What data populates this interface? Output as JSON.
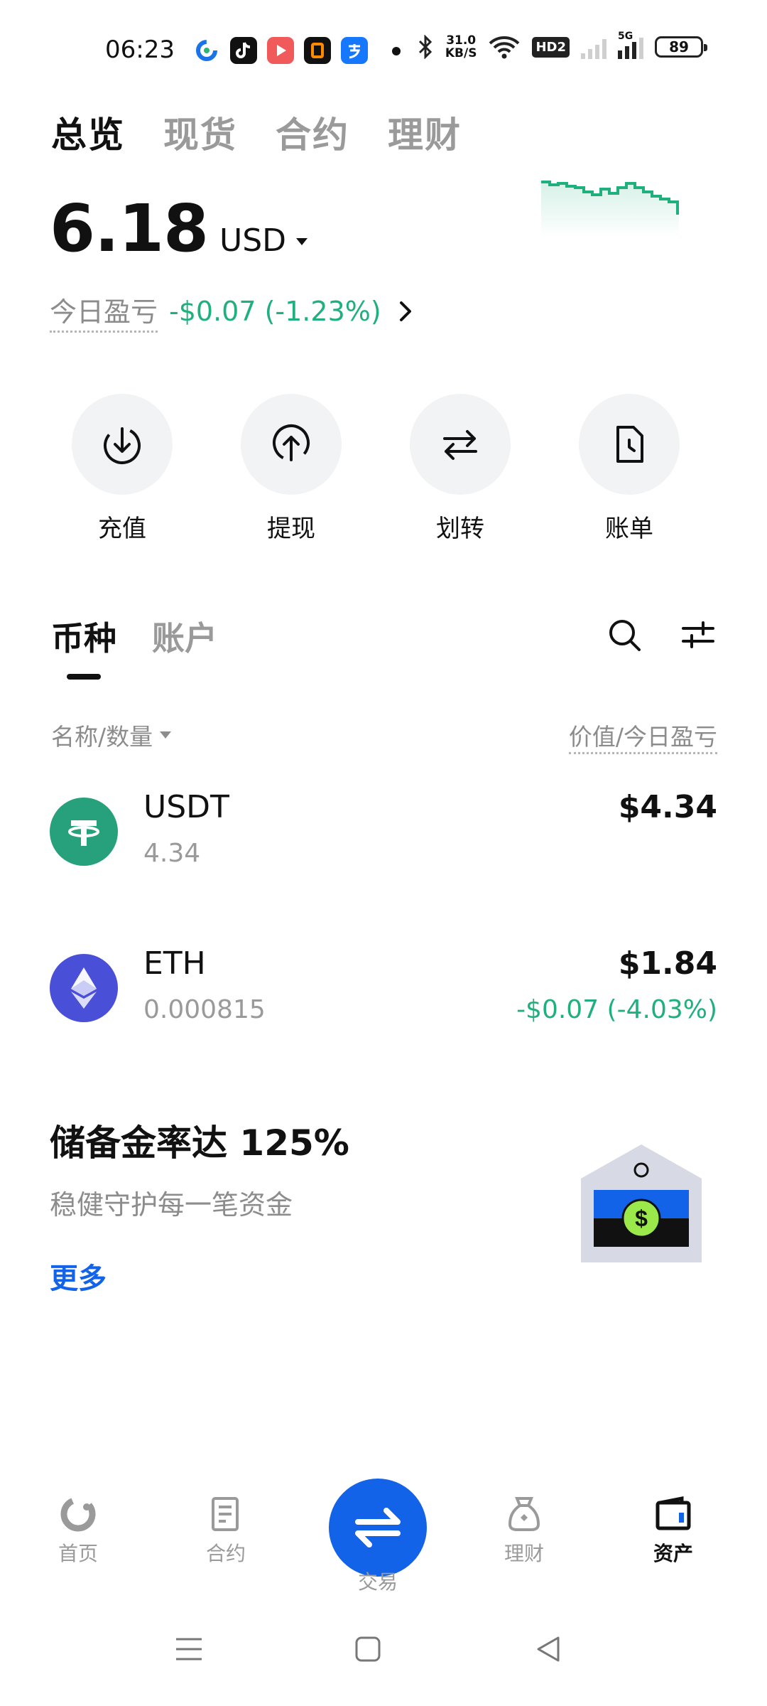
{
  "status_bar": {
    "time": "06:23",
    "net_speed_value": "31.0",
    "net_speed_unit": "KB/S",
    "hd_label": "HD2",
    "signal_label": "5G",
    "battery": "89",
    "notification_icons": [
      "data-app-icon",
      "tiktok-icon",
      "video-app-icon",
      "shopping-app-icon",
      "alipay-icon"
    ]
  },
  "top_tabs": [
    "总览",
    "现货",
    "合约",
    "理财"
  ],
  "balance": {
    "value": "6.18",
    "currency": "USD",
    "pnl_label": "今日盈亏",
    "pnl_value": "-$0.07 (-1.23%)"
  },
  "actions": [
    {
      "label": "充值",
      "icon": "deposit-icon"
    },
    {
      "label": "提现",
      "icon": "withdraw-icon"
    },
    {
      "label": "划转",
      "icon": "transfer-icon"
    },
    {
      "label": "账单",
      "icon": "bill-icon"
    }
  ],
  "asset_tabs": [
    "币种",
    "账户"
  ],
  "list_header": {
    "left": "名称/数量",
    "right": "价值/今日盈亏"
  },
  "assets": [
    {
      "name": "USDT",
      "quantity": "4.34",
      "value": "$4.34",
      "pnl": ""
    },
    {
      "name": "ETH",
      "quantity": "0.000815",
      "value": "$1.84",
      "pnl": "-$0.07 (-4.03%)"
    }
  ],
  "reserve": {
    "title": "储备金率达 125%",
    "subtitle": "稳健守护每一笔资金",
    "more": "更多"
  },
  "bottom_nav": [
    {
      "label": "首页",
      "icon": "home-icon"
    },
    {
      "label": "合约",
      "icon": "contract-icon"
    },
    {
      "label": "交易",
      "icon": "trade-icon"
    },
    {
      "label": "理财",
      "icon": "finance-icon"
    },
    {
      "label": "资产",
      "icon": "wallet-icon"
    }
  ],
  "colors": {
    "positive_green": "#1fb07d",
    "accent_blue": "#1363e8",
    "text_primary": "#111111",
    "text_secondary": "#8c8c8c"
  }
}
